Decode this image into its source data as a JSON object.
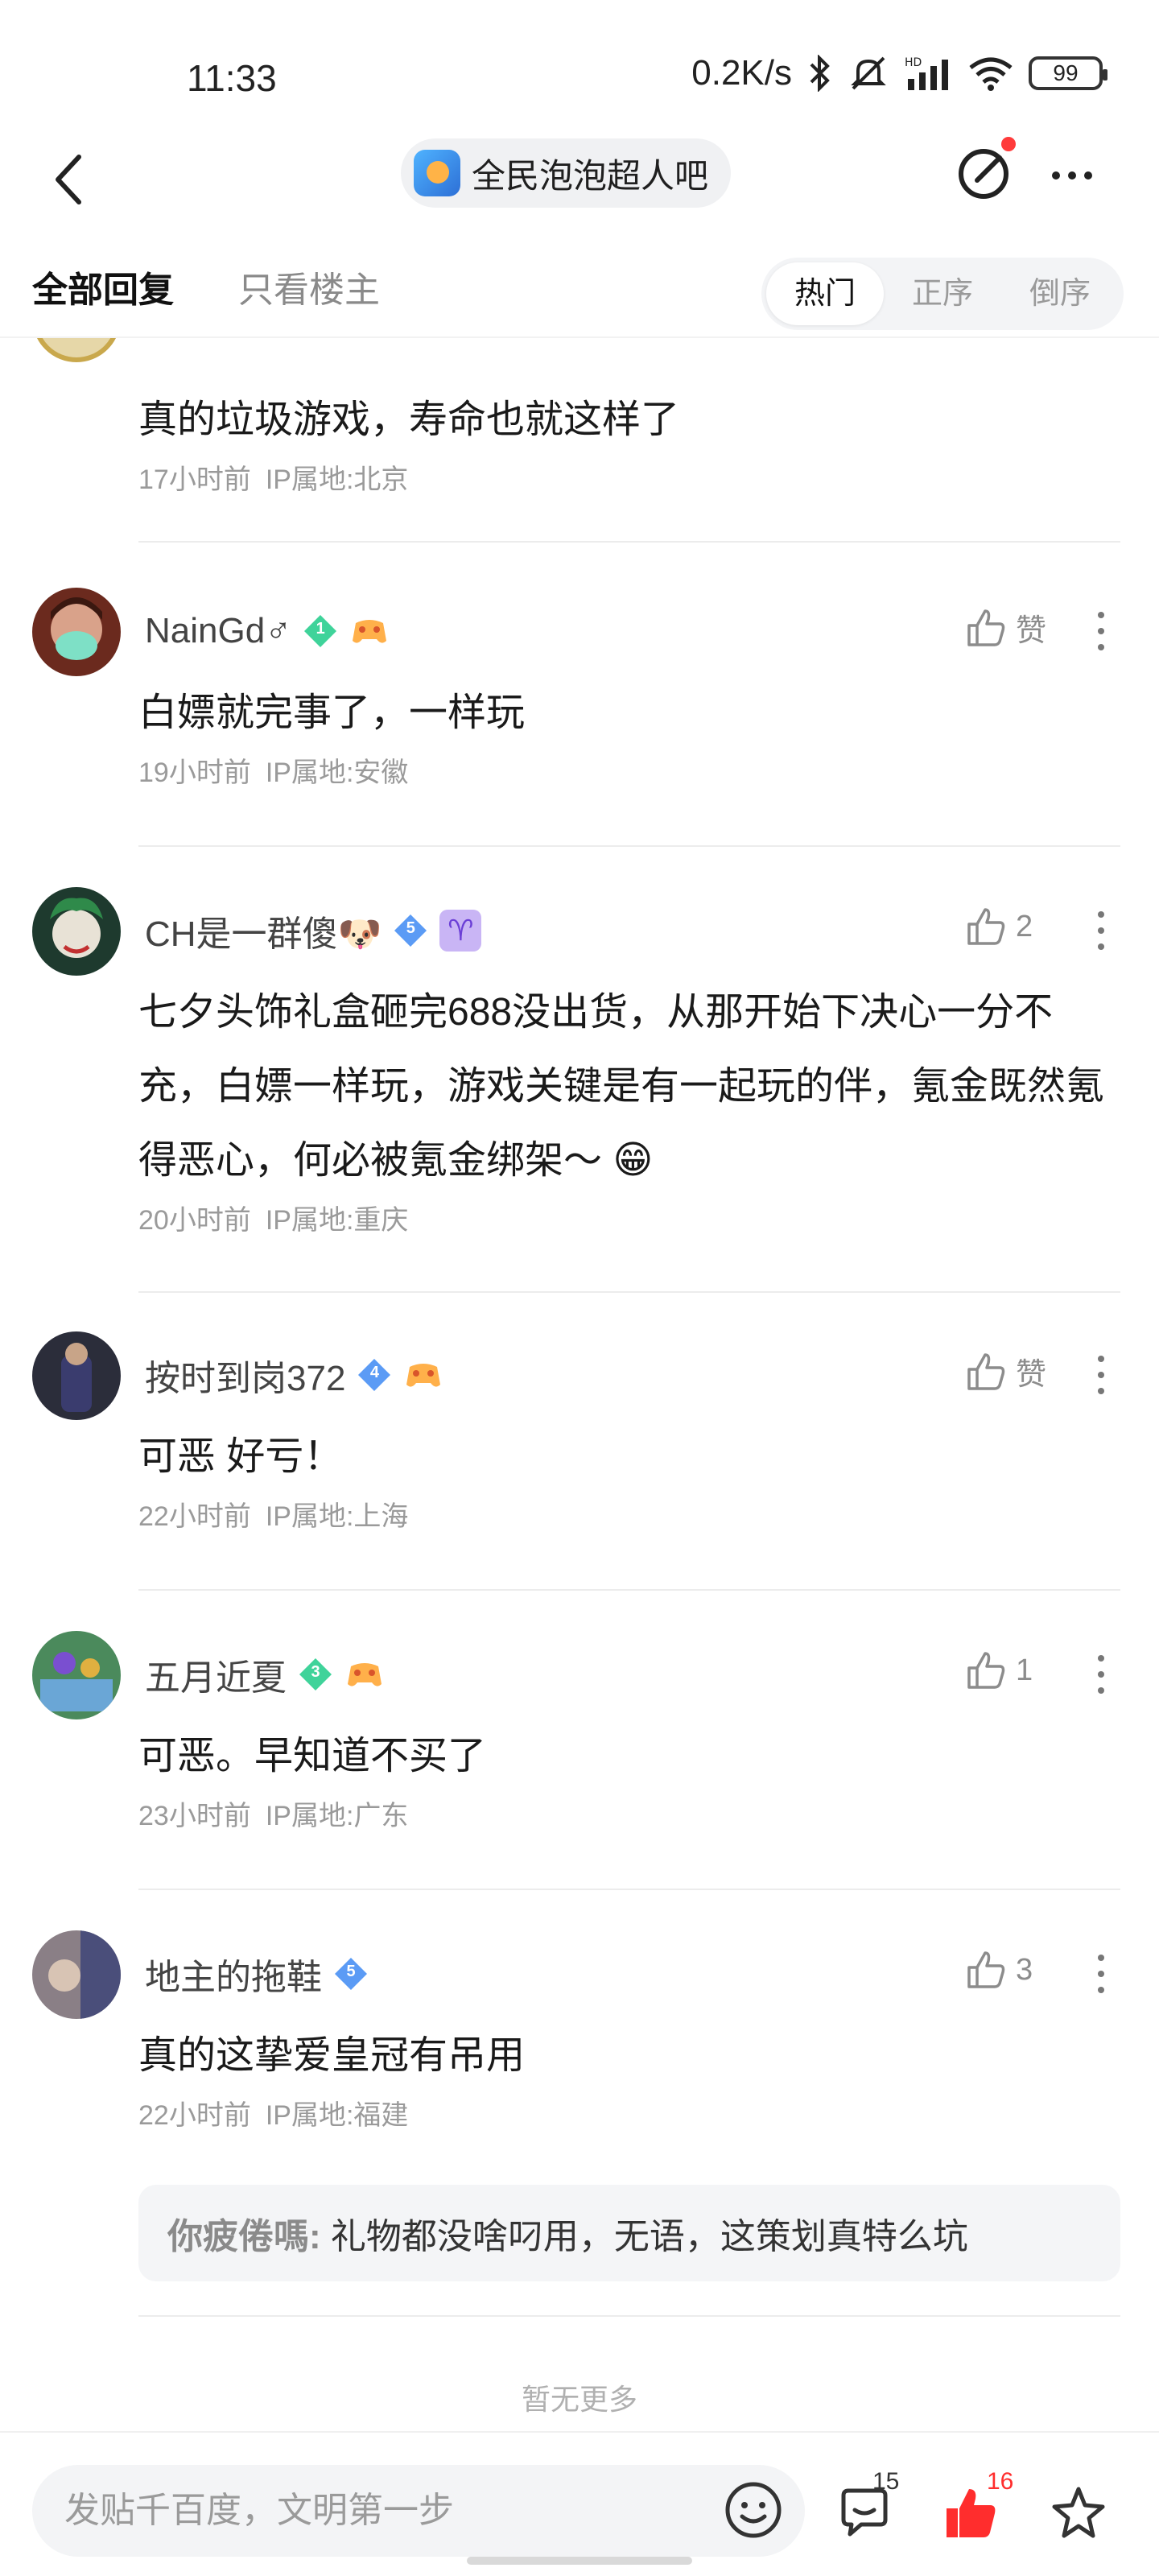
{
  "status": {
    "time": "11:33",
    "net_speed": "0.2K/s",
    "battery": "99"
  },
  "header": {
    "forum_name": "全民泡泡超人吧"
  },
  "tabs": {
    "all": "全部回复",
    "host_only": "只看楼主",
    "sort": [
      "热门",
      "正序",
      "倒序"
    ],
    "active_sort_index": 0
  },
  "partial_comment": {
    "text": "真的垃圾游戏，寿命也就这样了",
    "time": "17小时前",
    "ip": "IP属地:北京"
  },
  "comments": [
    {
      "username": "NainGd♂",
      "level": "1",
      "like_label": "赞",
      "text": "白嫖就完事了，一样玩",
      "time": "19小时前",
      "ip": "IP属地:安徽"
    },
    {
      "username": "CH是一群傻🐶",
      "level": "5",
      "like_label": "2",
      "text": "七夕头饰礼盒砸完688没出货，从那开始下决心一分不充，白嫖一样玩，游戏关键是有一起玩的伴，氪金既然氪得恶心，何必被氪金绑架～ 😁",
      "time": "20小时前",
      "ip": "IP属地:重庆"
    },
    {
      "username": "按时到岗372",
      "level": "4",
      "like_label": "赞",
      "text": "可恶 好亏！",
      "time": "22小时前",
      "ip": "IP属地:上海"
    },
    {
      "username": "五月近夏",
      "level": "3",
      "like_label": "1",
      "text": "可恶。早知道不买了",
      "time": "23小时前",
      "ip": "IP属地:广东"
    },
    {
      "username": "地主的拖鞋",
      "level": "5",
      "like_label": "3",
      "text": "真的这挚爱皇冠有吊用",
      "time": "22小时前",
      "ip": "IP属地:福建",
      "reply_author": "你疲倦嗎:",
      "reply_text": "礼物都没啥叼用，无语，这策划真特么坑"
    }
  ],
  "footer_note": "暂无更多",
  "bottom_bar": {
    "input_placeholder": "发贴千百度，文明第一步",
    "comment_count": "15",
    "like_count": "16"
  },
  "colors": {
    "accent_red": "#ff2d2d",
    "level_green": "#3fd39a",
    "level_blue": "#5b9bf5"
  }
}
